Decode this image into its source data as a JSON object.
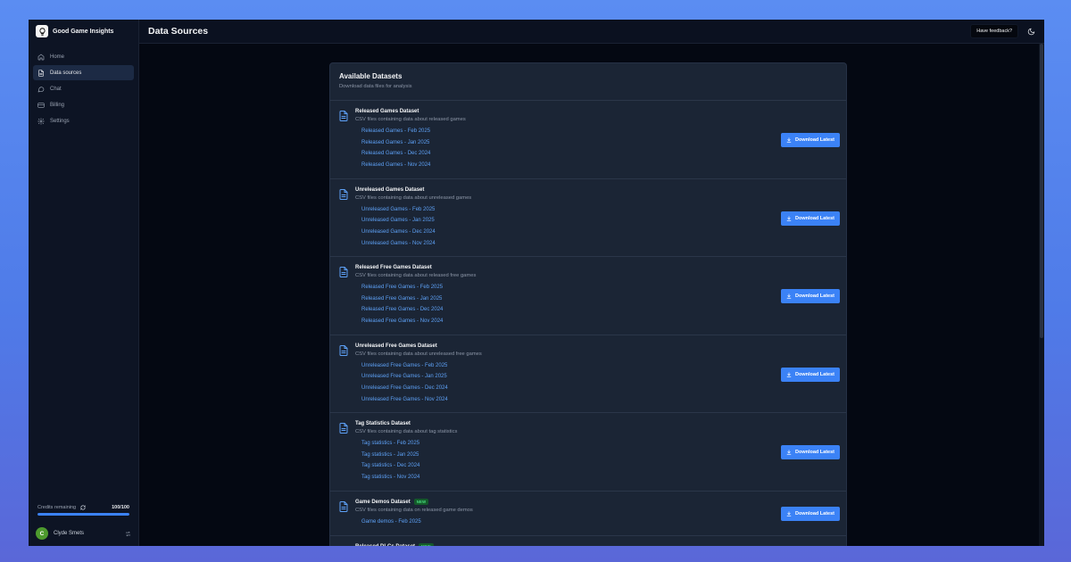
{
  "app": {
    "name": "Good Game Insights"
  },
  "sidebar": {
    "items": [
      {
        "label": "Home",
        "icon": "home-icon",
        "active": false
      },
      {
        "label": "Data sources",
        "icon": "file-icon",
        "active": true
      },
      {
        "label": "Chat",
        "icon": "chat-icon",
        "active": false
      },
      {
        "label": "Billing",
        "icon": "credit-card-icon",
        "active": false
      },
      {
        "label": "Settings",
        "icon": "gear-icon",
        "active": false
      }
    ],
    "credits": {
      "label": "Credits remaining",
      "value": "100/100",
      "fraction": 1.0
    },
    "user": {
      "initial": "C",
      "name": "Clyde Smets"
    }
  },
  "header": {
    "title": "Data Sources",
    "feedback_label": "Have feedback?"
  },
  "card": {
    "title": "Available Datasets",
    "subtitle": "Download data files for analysis",
    "button_label": "Download Latest",
    "datasets": [
      {
        "title": "Released Games Dataset",
        "description": "CSV files containing data about released games",
        "badge": "",
        "files": [
          "Released Games - Feb 2025",
          "Released Games - Jan 2025",
          "Released Games - Dec 2024",
          "Released Games - Nov 2024"
        ]
      },
      {
        "title": "Unreleased Games Dataset",
        "description": "CSV files containing data about unreleased games",
        "badge": "",
        "files": [
          "Unreleased Games - Feb 2025",
          "Unreleased Games - Jan 2025",
          "Unreleased Games - Dec 2024",
          "Unreleased Games - Nov 2024"
        ]
      },
      {
        "title": "Released Free Games Dataset",
        "description": "CSV files containing data about released free games",
        "badge": "",
        "files": [
          "Released Free Games - Feb 2025",
          "Released Free Games - Jan 2025",
          "Released Free Games - Dec 2024",
          "Released Free Games - Nov 2024"
        ]
      },
      {
        "title": "Unreleased Free Games Dataset",
        "description": "CSV files containing data about unreleased free games",
        "badge": "",
        "files": [
          "Unreleased Free Games - Feb 2025",
          "Unreleased Free Games - Jan 2025",
          "Unreleased Free Games - Dec 2024",
          "Unreleased Free Games - Nov 2024"
        ]
      },
      {
        "title": "Tag Statistics Dataset",
        "description": "CSV files containing data about tag statistics",
        "badge": "",
        "files": [
          "Tag statistics - Feb 2025",
          "Tag statistics - Jan 2025",
          "Tag statistics - Dec 2024",
          "Tag statistics - Nov 2024"
        ]
      },
      {
        "title": "Game Demos Dataset",
        "description": "CSV files containing data on released game demos",
        "badge": "NEW",
        "files": [
          "Game demos - Feb 2025"
        ]
      },
      {
        "title": "Released DLCs Dataset",
        "description": "",
        "badge": "NEW",
        "files": []
      }
    ]
  },
  "colors": {
    "accent": "#3b82f6",
    "link": "#5da0f5",
    "badge_bg": "#145a2b",
    "badge_text": "#4ade80"
  }
}
